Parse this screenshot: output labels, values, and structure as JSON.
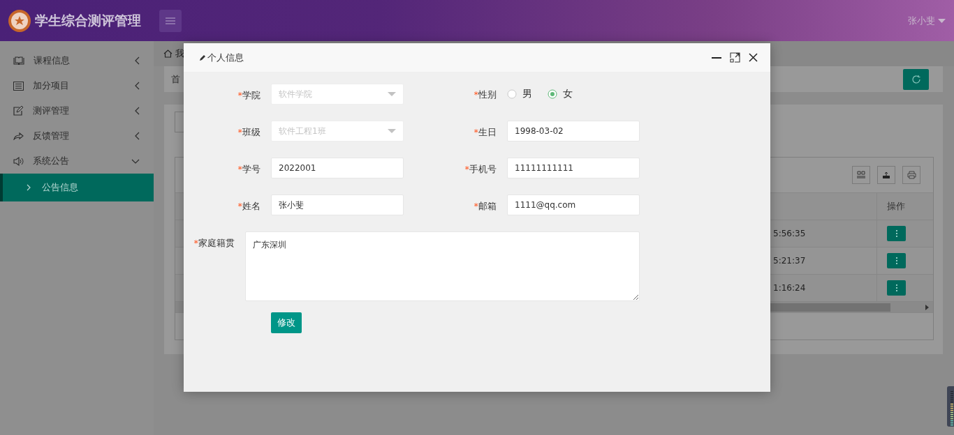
{
  "header": {
    "title": "学生综合测评管理",
    "user": "张小斐"
  },
  "sidebar": {
    "items": [
      {
        "label": "课程信息",
        "expanded": false
      },
      {
        "label": "加分项目",
        "expanded": false
      },
      {
        "label": "测评管理",
        "expanded": false
      },
      {
        "label": "反馈管理",
        "expanded": false
      },
      {
        "label": "系统公告",
        "expanded": true,
        "children": [
          {
            "label": "公告信息",
            "selected": true
          }
        ]
      }
    ]
  },
  "breadcrumb": "我",
  "tab_bar": {
    "tab": "首"
  },
  "table": {
    "columns": [
      {
        "label": "操作"
      }
    ],
    "rows": [
      {
        "column_1": "5:56:35"
      },
      {
        "column_1": "5:21:37"
      },
      {
        "column_1": "1:16:24"
      }
    ]
  },
  "dialog": {
    "title": "个人信息",
    "fields": [
      {
        "kind": "select",
        "label": "学院",
        "required_mark": "*",
        "value": "软件学院",
        "disabled": true
      },
      {
        "kind": "radio",
        "label": "性别",
        "required_mark": "*",
        "options": [
          {
            "label": "男",
            "selected": false
          },
          {
            "label": "女",
            "selected": true
          }
        ]
      },
      {
        "kind": "select",
        "label": "班级",
        "required_mark": "*",
        "value": "软件工程1班",
        "disabled": true
      },
      {
        "kind": "input",
        "label": "生日",
        "required_mark": "*",
        "value": "1998-03-02"
      },
      {
        "kind": "input",
        "label": "学号",
        "required_mark": "*",
        "value": "2022001"
      },
      {
        "kind": "input",
        "label": "手机号",
        "required_mark": "*",
        "value": "11111111111"
      },
      {
        "kind": "input",
        "label": "姓名",
        "required_mark": "*",
        "value": "张小斐"
      },
      {
        "kind": "input",
        "label": "邮箱",
        "required_mark": "*",
        "value": "1111@qq.com"
      },
      {
        "kind": "textarea",
        "label": "家庭籍贯",
        "required_mark": "*",
        "value": "广东深圳"
      }
    ],
    "submit": "修改"
  }
}
